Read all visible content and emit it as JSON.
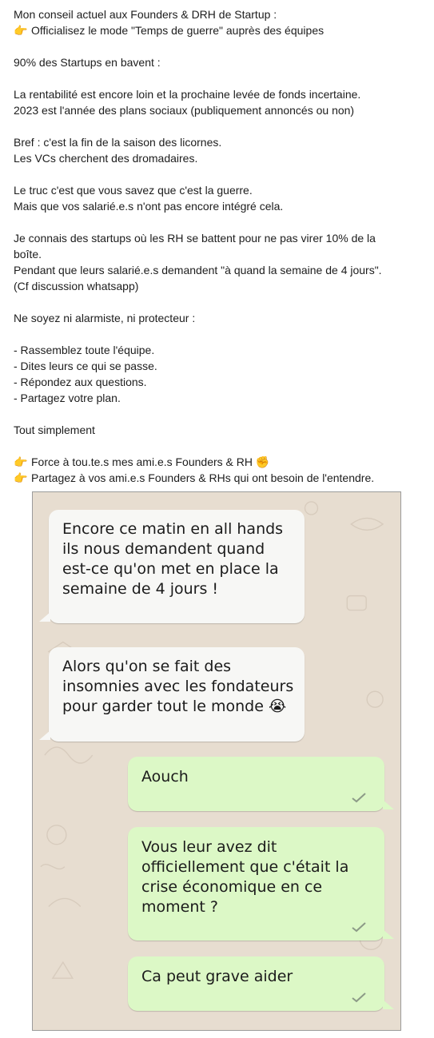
{
  "post": {
    "lines": [
      "Mon conseil actuel aux Founders & DRH de Startup :",
      "Officialisez le mode \"Temps de guerre\" auprès des équipes",
      "",
      "90% des Startups en bavent :",
      "",
      "La rentabilité est encore loin et la prochaine levée de fonds incertaine.",
      "2023 est l'année des plans sociaux (publiquement annoncés ou non)",
      "",
      "Bref : c'est la fin de la saison des licornes.",
      "Les VCs cherchent des dromadaires.",
      "",
      "Le truc c'est que vous savez que c'est la guerre.",
      "Mais que vos salarié.e.s n'ont pas encore intégré cela.",
      "",
      "Je connais des startups où les RH se battent pour ne pas virer 10% de la",
      "boîte.",
      "Pendant que leurs salarié.e.s demandent \"à quand la semaine de 4 jours\".",
      "(Cf discussion whatsapp)",
      "",
      "Ne soyez ni alarmiste, ni protecteur :",
      "",
      "- Rassemblez toute l'équipe.",
      "- Dites leurs ce qui se passe.",
      "- Répondez aux questions.",
      "- Partagez votre plan.",
      "",
      "Tout simplement",
      "",
      "Force à tou.te.s mes ami.e.s Founders & RH ✊",
      "Partagez à vos ami.e.s Founders & RHs qui ont besoin de l'entendre."
    ],
    "pointer_icon": "👉",
    "pointer_lines": [
      1,
      28,
      29
    ]
  },
  "chat": {
    "messages": [
      {
        "side": "in",
        "lines": [
          "Encore ce matin en all hands",
          "ils nous demandent quand",
          "est-ce qu'on met en place la",
          "semaine de 4 jours !"
        ]
      },
      {
        "side": "in",
        "lines": [
          "Alors qu'on se fait des",
          "insomnies avec les fondateurs",
          "pour garder tout le monde 😭"
        ]
      },
      {
        "side": "out",
        "lines": [
          "Aouch"
        ]
      },
      {
        "side": "out",
        "lines": [
          "Vous leur avez dit",
          "officiellement que c'était la",
          "crise économique en ce",
          "moment ?"
        ]
      },
      {
        "side": "out",
        "lines": [
          "Ca peut grave aider"
        ]
      }
    ],
    "colors": {
      "incoming": "#f7f7f5",
      "outgoing": "#dcf8c6",
      "wallpaper": "#e7ddd0",
      "tick": "#8c9a87"
    },
    "tick_icon": "check-icon"
  }
}
